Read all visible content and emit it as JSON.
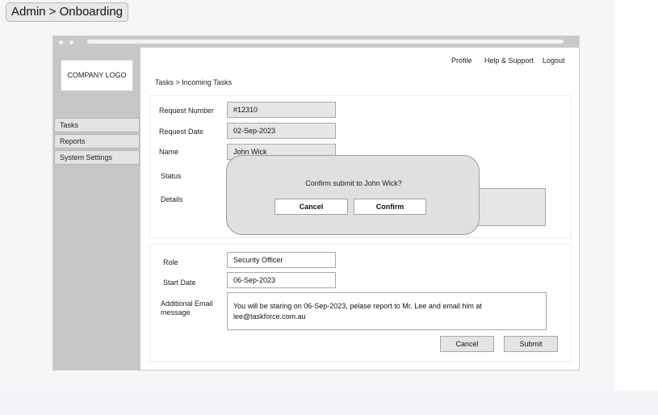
{
  "page_chip": "Admin > Onboarding",
  "sidebar": {
    "logo": "COMPANY LOGO",
    "items": [
      {
        "label": "Tasks"
      },
      {
        "label": "Reports"
      },
      {
        "label": "System Settings"
      }
    ]
  },
  "header": {
    "links": [
      "Profile",
      "Help & Support",
      "Logout"
    ],
    "breadcrumb": "Tasks > Incoming Tasks"
  },
  "request": {
    "number_label": "Request Number",
    "number_value": "#12310",
    "date_label": "Request Date",
    "date_value": "02-Sep-2023",
    "name_label": "Name",
    "name_value": "John Wick",
    "status_label": "Status",
    "details_label": "Details"
  },
  "onboarding": {
    "role_label": "Role",
    "role_value": "Security Officer",
    "start_label": "Start Date",
    "start_value": "06-Sep-2023",
    "email_label": "Additional Email message",
    "email_value": "You will be staring on 06-Sep-2023, pelase report to Mr. Lee and email him at lee@taskforce.com.au",
    "cancel_label": "Cancel",
    "submit_label": "Submit"
  },
  "modal": {
    "message": "Confirm submit to John Wick?",
    "cancel_label": "Cancel",
    "confirm_label": "Confirm"
  }
}
